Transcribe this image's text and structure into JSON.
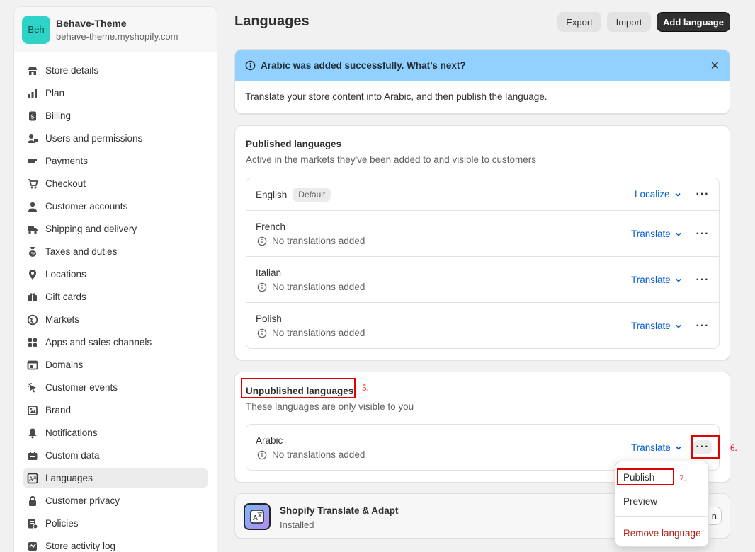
{
  "store": {
    "avatar": "Beh",
    "name": "Behave-Theme",
    "url": "behave-theme.myshopify.com",
    "accent": "#2ed3c8"
  },
  "sidebar": {
    "items": [
      {
        "label": "Store details",
        "icon": "store-icon"
      },
      {
        "label": "Plan",
        "icon": "plan-icon"
      },
      {
        "label": "Billing",
        "icon": "billing-icon"
      },
      {
        "label": "Users and permissions",
        "icon": "users-icon"
      },
      {
        "label": "Payments",
        "icon": "payments-icon"
      },
      {
        "label": "Checkout",
        "icon": "cart-icon"
      },
      {
        "label": "Customer accounts",
        "icon": "person-icon"
      },
      {
        "label": "Shipping and delivery",
        "icon": "truck-icon"
      },
      {
        "label": "Taxes and duties",
        "icon": "taxes-icon"
      },
      {
        "label": "Locations",
        "icon": "location-icon"
      },
      {
        "label": "Gift cards",
        "icon": "gift-icon"
      },
      {
        "label": "Markets",
        "icon": "globe-icon"
      },
      {
        "label": "Apps and sales channels",
        "icon": "apps-icon"
      },
      {
        "label": "Domains",
        "icon": "domains-icon"
      },
      {
        "label": "Customer events",
        "icon": "cursor-icon"
      },
      {
        "label": "Brand",
        "icon": "brand-icon"
      },
      {
        "label": "Notifications",
        "icon": "bell-icon"
      },
      {
        "label": "Custom data",
        "icon": "custom-data-icon"
      },
      {
        "label": "Languages",
        "icon": "language-icon",
        "active": true
      },
      {
        "label": "Customer privacy",
        "icon": "lock-icon"
      },
      {
        "label": "Policies",
        "icon": "policies-icon"
      },
      {
        "label": "Store activity log",
        "icon": "activity-icon"
      }
    ]
  },
  "header": {
    "title": "Languages",
    "export_label": "Export",
    "import_label": "Import",
    "add_label": "Add language"
  },
  "banner": {
    "title": "Arabic was added successfully. What’s next?",
    "body": "Translate your store content into Arabic, and then publish the language.",
    "color": "#91d0ff"
  },
  "published": {
    "title": "Published languages",
    "subtitle": "Active in the markets they've been added to and visible to customers",
    "rows": [
      {
        "name": "English",
        "badge": "Default",
        "action": "Localize",
        "note": ""
      },
      {
        "name": "French",
        "badge": "",
        "action": "Translate",
        "note": "No translations added"
      },
      {
        "name": "Italian",
        "badge": "",
        "action": "Translate",
        "note": "No translations added"
      },
      {
        "name": "Polish",
        "badge": "",
        "action": "Translate",
        "note": "No translations added"
      }
    ]
  },
  "unpublished": {
    "title": "Unpublished languages",
    "subtitle": "These languages are only visible to you",
    "rows": [
      {
        "name": "Arabic",
        "action": "Translate",
        "note": "No translations added"
      }
    ]
  },
  "app": {
    "name": "Shopify Translate & Adapt",
    "status": "Installed",
    "button_partial": "n"
  },
  "menu": {
    "publish": "Publish",
    "preview": "Preview",
    "remove": "Remove language"
  },
  "annotations": {
    "step5": "5.",
    "step6": "6.",
    "step7": "7.",
    "color": "#e00000"
  }
}
